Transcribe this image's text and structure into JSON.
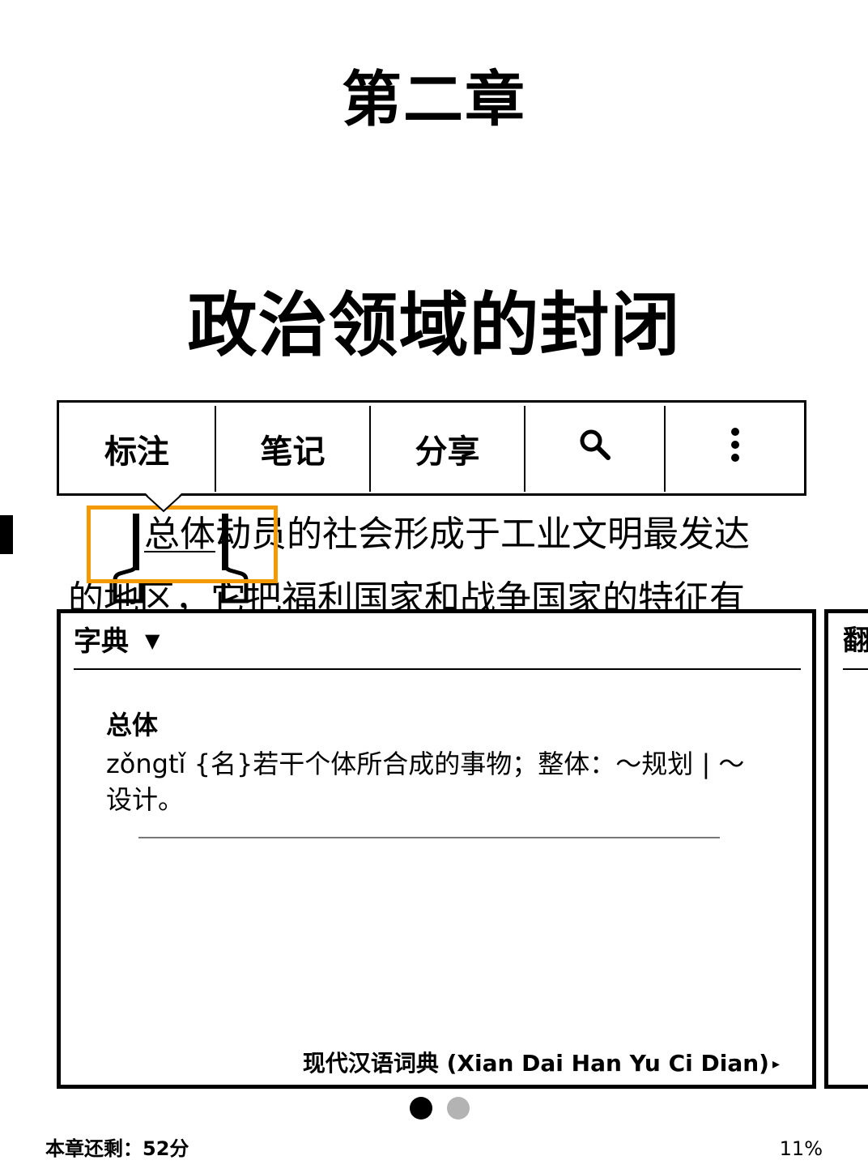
{
  "book": {
    "chapter_label": "第二章",
    "chapter_title": "政治领域的封闭",
    "line1_selected": "总体",
    "line1_rest": "动员的社会形成于工业文明最发达",
    "line2": "的地区，它把福利国家和战争国家的特征有"
  },
  "toolbar": {
    "highlight_label": "标注",
    "note_label": "笔记",
    "share_label": "分享",
    "search_icon": "search-icon",
    "more_icon": "more-vertical-icon"
  },
  "dictionary": {
    "header": "字典",
    "caret": "▼",
    "headword": "总体",
    "definition": "zǒngtǐ {名}若干个体所合成的事物；整体：～规划 | ～设计。",
    "source": "现代汉语词典 (Xian Dai Han Yu Ci Dian)",
    "source_arrow": "▸"
  },
  "next_panel": {
    "title": "翻译"
  },
  "footer": {
    "time_left": "本章还剩：52分",
    "progress": "11%"
  },
  "colors": {
    "selection_highlight": "#f29a00",
    "inactive_dot": "#b3b3b3"
  }
}
